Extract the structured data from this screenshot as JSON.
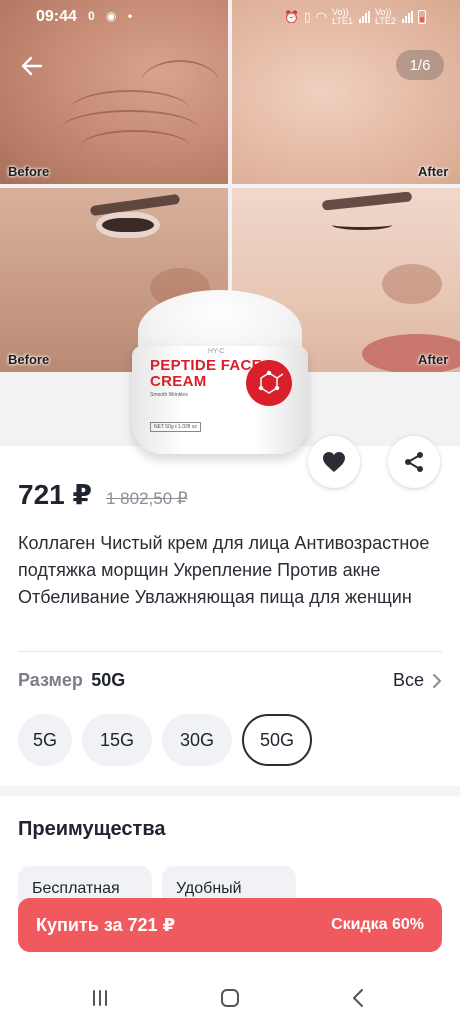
{
  "status_bar": {
    "time": "09:44",
    "notification_count": "0",
    "network_labels": [
      "Vo)) LTE1",
      "Vo)) LTE2"
    ]
  },
  "gallery": {
    "counter": "1/6",
    "captions": {
      "before_top": "Before",
      "after_top": "After",
      "before_bottom": "Before",
      "after_bottom": "After"
    },
    "jar": {
      "brand": "HY-C",
      "title_line1": "PEPTIDE FACE",
      "title_line2": "CREAM",
      "subtitle": "Smooth Wrinkles",
      "net": "NET 50g ℓ 1.02fl oz"
    }
  },
  "product": {
    "price": "721 ₽",
    "old_price": "1 802,50 ₽",
    "title": "Коллаген Чистый крем для лица Антивозрастное подтяжка морщин Укрепление Против акне Отбеливание Увлажняющая пища для женщин"
  },
  "size": {
    "label": "Размер",
    "selected": "50G",
    "all_label": "Все",
    "options": [
      "5G",
      "15G",
      "30G",
      "50G"
    ]
  },
  "advantages": {
    "title": "Преимущества",
    "cards": [
      "Бесплатная",
      "Удобный"
    ]
  },
  "buy": {
    "label": "Купить за 721 ₽",
    "discount": "Скидка 60%"
  },
  "colors": {
    "accent": "#f05a5e",
    "text": "#1f2430",
    "muted": "#8b8e97",
    "chip_bg": "#f1f2f5"
  },
  "icons": {
    "back": "arrow-left-icon",
    "favorite": "heart-icon",
    "share": "share-icon",
    "all_chevron": "chevron-right-icon",
    "nav_recent": "recent-apps-icon",
    "nav_home": "home-icon",
    "nav_back": "nav-back-icon"
  }
}
